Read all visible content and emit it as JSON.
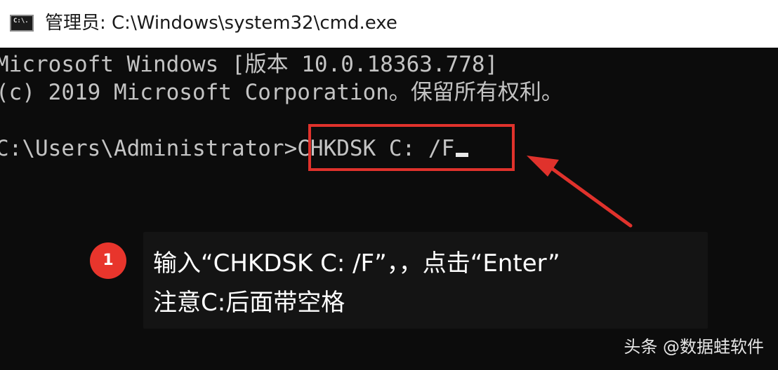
{
  "window": {
    "icon": "cmd-icon",
    "icon_text": "C:\\.",
    "title": "管理员: C:\\Windows\\system32\\cmd.exe"
  },
  "console": {
    "line1": "Microsoft Windows [版本 10.0.18363.778]",
    "line2": "(c) 2019 Microsoft Corporation。保留所有权利。",
    "prompt": "C:\\Users\\Administrator>",
    "command": "CHKDSK C: /F"
  },
  "annotation": {
    "badge_number": "1",
    "line1": "输入“CHKDSK C: /F”，，点击“Enter”",
    "line2": "注意C:后面带空格",
    "highlight_color": "#e0322c",
    "badge_color": "#e8352c"
  },
  "watermark": {
    "text": "头条 @数据蛙软件"
  }
}
